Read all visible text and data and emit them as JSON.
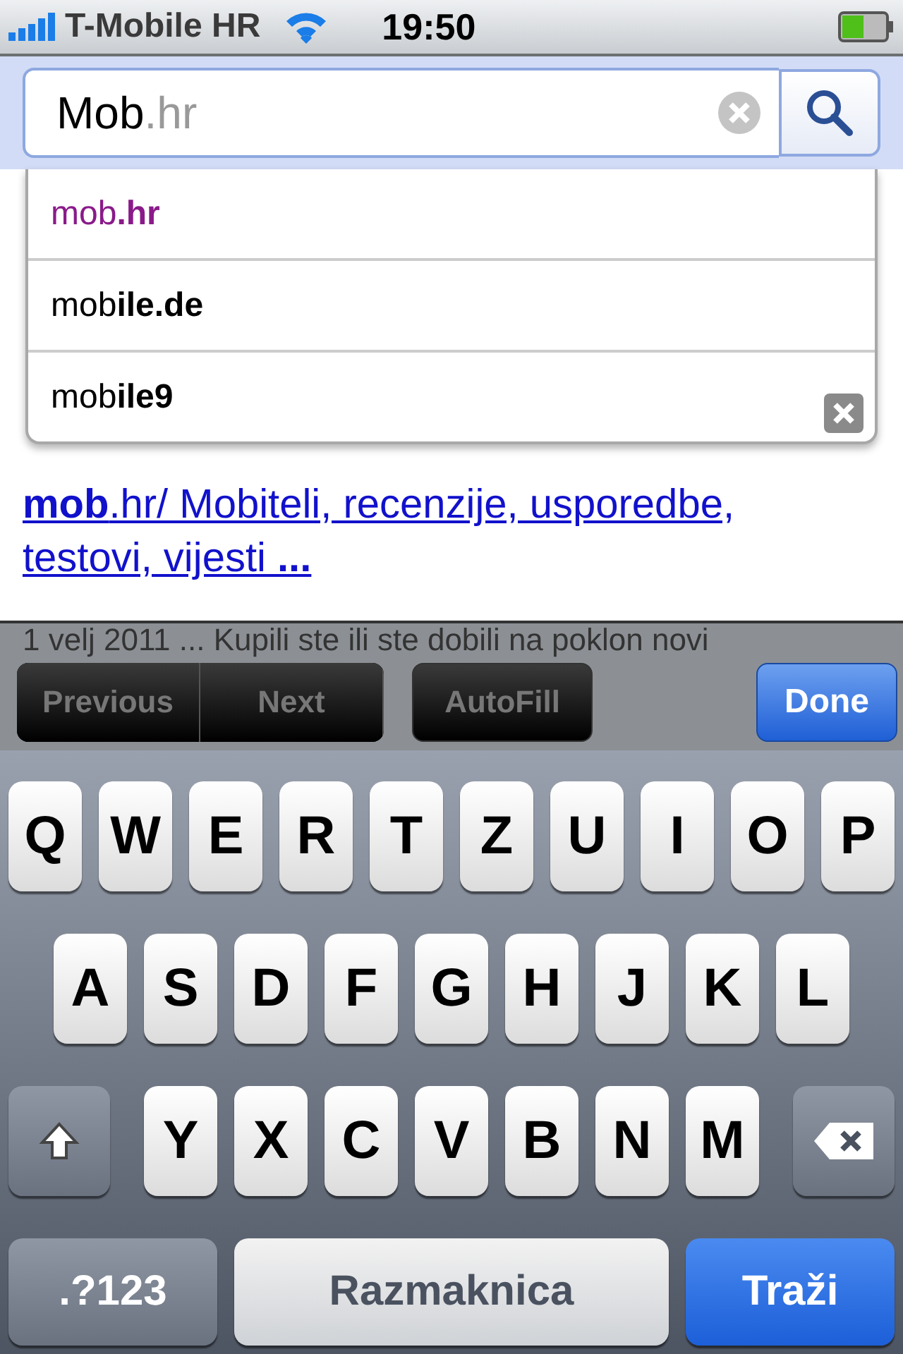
{
  "status_bar": {
    "carrier": "T-Mobile HR",
    "time": "19:50"
  },
  "search": {
    "value": "Mob",
    "completion": ".hr"
  },
  "suggestions": [
    {
      "text": "mob**.hr**",
      "visited": true
    },
    {
      "text": "mob**ile.de**",
      "visited": false
    },
    {
      "text": "mob**ile9**",
      "visited": false
    }
  ],
  "result": {
    "link": "**mob**.hr/ Mobiteli, recenzije, usporedbe, testovi, vijesti **...**",
    "snippet": "1 velj 2011 ... Kupili ste ili ste dobili na poklon novi"
  },
  "toolbar": {
    "buttons": [
      {
        "label": "Previous",
        "kind": "segment",
        "disabled": true
      },
      {
        "label": "Next",
        "kind": "segment",
        "disabled": true
      },
      {
        "label": "AutoFill",
        "kind": "plain",
        "disabled": true
      },
      {
        "label": "Done",
        "kind": "primary",
        "disabled": false
      }
    ]
  },
  "keyboard": {
    "rows": [
      {
        "keys": [
          {
            "kind": "letter",
            "label": "Q"
          },
          {
            "kind": "letter",
            "label": "W"
          },
          {
            "kind": "letter",
            "label": "E"
          },
          {
            "kind": "letter",
            "label": "R"
          },
          {
            "kind": "letter",
            "label": "T"
          },
          {
            "kind": "letter",
            "label": "Z"
          },
          {
            "kind": "letter",
            "label": "U"
          },
          {
            "kind": "letter",
            "label": "I"
          },
          {
            "kind": "letter",
            "label": "O"
          },
          {
            "kind": "letter",
            "label": "P"
          }
        ]
      },
      {
        "keys": [
          {
            "kind": "letter",
            "label": "A"
          },
          {
            "kind": "letter",
            "label": "S"
          },
          {
            "kind": "letter",
            "label": "D"
          },
          {
            "kind": "letter",
            "label": "F"
          },
          {
            "kind": "letter",
            "label": "G"
          },
          {
            "kind": "letter",
            "label": "H"
          },
          {
            "kind": "letter",
            "label": "J"
          },
          {
            "kind": "letter",
            "label": "K"
          },
          {
            "kind": "letter",
            "label": "L"
          }
        ]
      },
      {
        "keys": [
          {
            "kind": "shift"
          },
          {
            "kind": "letter",
            "label": "Y"
          },
          {
            "kind": "letter",
            "label": "X"
          },
          {
            "kind": "letter",
            "label": "C"
          },
          {
            "kind": "letter",
            "label": "V"
          },
          {
            "kind": "letter",
            "label": "B"
          },
          {
            "kind": "letter",
            "label": "N"
          },
          {
            "kind": "letter",
            "label": "M"
          },
          {
            "kind": "delete"
          }
        ]
      },
      {
        "keys": [
          {
            "kind": "mode",
            "label": ".?123"
          },
          {
            "kind": "space",
            "label": "Razmaknica"
          },
          {
            "kind": "action",
            "label": "Traži"
          }
        ]
      }
    ]
  }
}
